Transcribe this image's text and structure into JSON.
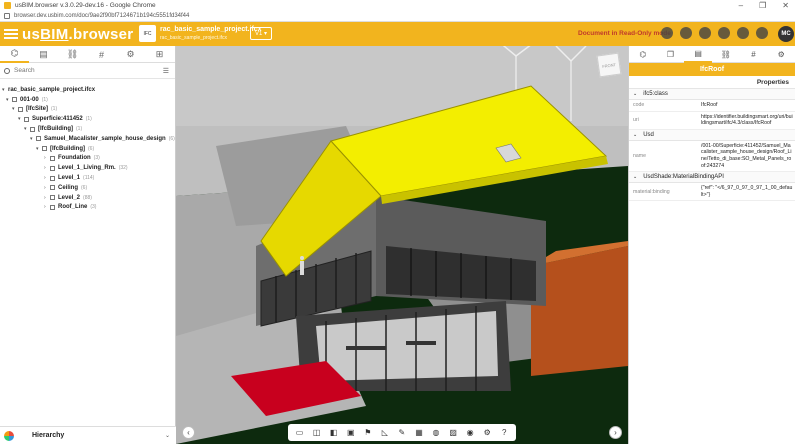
{
  "browser": {
    "window_title": "usBIM.browser v.3.0.29-dev.16 - Google Chrome",
    "url": "browser.dev.usbim.com/doc/9ae2f90bf7124671b194c5551fd34f44",
    "win_minimize": "–",
    "win_restore": "❐",
    "win_close": "✕"
  },
  "app": {
    "logo_us": "us",
    "logo_bim": "BIM",
    "logo_rest": ".browser",
    "thumb_label": "IFC",
    "project_title": "rac_basic_sample_project.ifcx",
    "project_sub": "rac_basic_sample_project.ifcx",
    "version": "V1 ▾",
    "readonly_label": "Document in Read-Only mode",
    "avatar_initials": "MC"
  },
  "left": {
    "search_placeholder": "Search",
    "bottom_label": "Hierarchy",
    "bottom_chevron": "⌄",
    "tree": [
      {
        "label": "rac_basic_sample_project.ifcx",
        "bold": true,
        "count": ""
      },
      {
        "label": "001-00",
        "bold": true,
        "count": "(1)"
      },
      {
        "label": "[IfcSite]",
        "bold": true,
        "count": "(1)"
      },
      {
        "label": "Superficie:411452",
        "bold": true,
        "count": "(1)"
      },
      {
        "label": "[IfcBuilding]",
        "bold": true,
        "count": "(1)"
      },
      {
        "label": "Samuel_Macalister_sample_house_design",
        "bold": true,
        "count": "(6)"
      },
      {
        "label": "[IfcBuilding]",
        "bold": true,
        "count": "(6)"
      },
      {
        "label": "Foundation",
        "bold": true,
        "count": "(3)"
      },
      {
        "label": "Level_1_Living_Rm.",
        "bold": true,
        "count": "(32)"
      },
      {
        "label": "Level_1",
        "bold": true,
        "count": "(114)"
      },
      {
        "label": "Ceiling",
        "bold": true,
        "count": "(6)"
      },
      {
        "label": "Level_2",
        "bold": true,
        "count": "(88)"
      },
      {
        "label": "Roof_Line",
        "bold": true,
        "count": "(3)"
      }
    ]
  },
  "right": {
    "title": "IfcRoof",
    "properties_label": "Properties",
    "sections": [
      {
        "name": "ifc5:class",
        "rows": [
          {
            "key": "code",
            "value": "IfcRoof"
          },
          {
            "key": "uri",
            "value": "https://identifier.buildingsmart.org/uri/buildingsmart/ifc/4.3/class/IfcRoof"
          }
        ]
      },
      {
        "name": "Usd",
        "rows": [
          {
            "key": "name",
            "value": "/001-00/Superficie:411452/Samuel_Macalister_sample_house_design/Roof_Line/Tetto_di_base:SO_Metal_Panels_roof:243274"
          }
        ]
      },
      {
        "name": "UsdShade:MaterialBindingAPI",
        "rows": [
          {
            "key": "material:binding",
            "value": "{\"ref\": \"</6_97_0_97_0_97_1_00_default>\"}"
          }
        ]
      }
    ]
  },
  "viewport": {
    "cube_label": "FRONT",
    "nav_prev": "‹",
    "nav_next": "›"
  },
  "colors": {
    "accent": "#f2b41e",
    "roof_selected": "#f3ee00",
    "readonly": "#c0392b"
  }
}
